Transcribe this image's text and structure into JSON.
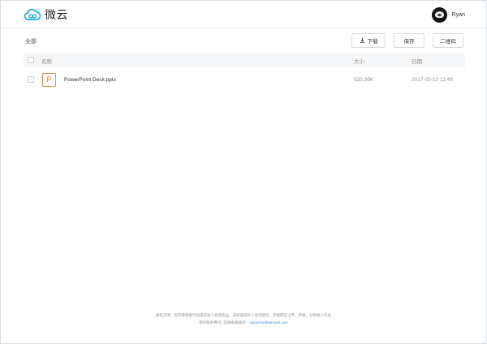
{
  "header": {
    "app_name": "微云",
    "user_name": "Ryan",
    "brand_color": "#3ab4e6"
  },
  "breadcrumb": {
    "label": "全部"
  },
  "toolbar": {
    "download_label": "下载",
    "save_label": "保存",
    "qr_label": "二维码"
  },
  "table": {
    "columns": {
      "name": "名称",
      "size": "大小",
      "date": "日期"
    },
    "rows": [
      {
        "icon_letter": "P",
        "icon_type": "pptx-file-icon",
        "name": "PowerPoint Deck.pptx",
        "size": "520.39K",
        "date": "2017-05-12 11:40"
      }
    ]
  },
  "footer": {
    "line1": "版权声明：您仅需要能代码操作权人会话权益，未经操作权人会话授权，不能擅自上传、存储、分享他人作品",
    "line2_prefix": "侵权联系腾讯 | 官微邮箱联系：",
    "email": "notice-b2@tencent.com"
  }
}
